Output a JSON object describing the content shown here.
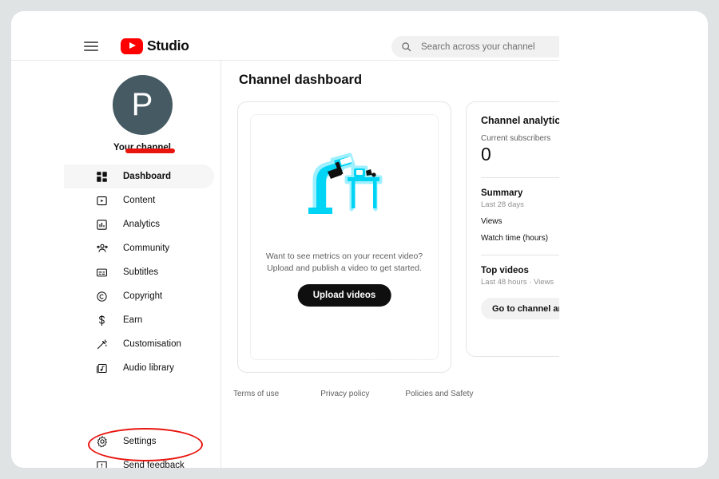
{
  "topbar": {
    "menu_icon": "hamburger-menu-icon",
    "brand_name": "Studio",
    "logo_icon": "youtube-logo-icon",
    "search": {
      "icon": "search-icon",
      "placeholder": "Search across your channel",
      "value": ""
    }
  },
  "sidebar": {
    "avatar_initial": "P",
    "channel_label": "Your channel",
    "items": [
      {
        "label": "Dashboard",
        "icon": "dashboard-grid-icon",
        "active": true
      },
      {
        "label": "Content",
        "icon": "content-video-icon",
        "active": false
      },
      {
        "label": "Analytics",
        "icon": "analytics-bar-icon",
        "active": false
      },
      {
        "label": "Community",
        "icon": "community-people-icon",
        "active": false
      },
      {
        "label": "Subtitles",
        "icon": "subtitles-icon",
        "active": false
      },
      {
        "label": "Copyright",
        "icon": "copyright-icon",
        "active": false
      },
      {
        "label": "Earn",
        "icon": "earn-dollar-icon",
        "active": false
      },
      {
        "label": "Customisation",
        "icon": "customisation-wand-icon",
        "active": false
      },
      {
        "label": "Audio library",
        "icon": "audio-library-icon",
        "active": false
      }
    ],
    "bottom_items": [
      {
        "label": "Settings",
        "icon": "settings-gear-icon"
      },
      {
        "label": "Send feedback",
        "icon": "send-feedback-icon"
      }
    ]
  },
  "annotations": {
    "underline_color": "#e8150f",
    "ellipse_color": "#e8150f",
    "underline_target": "Your channel",
    "ellipse_target": "Settings"
  },
  "main": {
    "page_title": "Channel dashboard",
    "upload_card": {
      "illustration": "person-filming-video-illustration",
      "illustration_color": "#26d9ee",
      "message_line1": "Want to see metrics on your recent video?",
      "message_line2": "Upload and publish a video to get started.",
      "upload_button": "Upload videos"
    },
    "analytics": {
      "title": "Channel analytics",
      "subscribers_label": "Current subscribers",
      "subscribers_value": "0",
      "summary_heading": "Summary",
      "summary_period": "Last 28 days",
      "metrics": [
        "Views",
        "Watch time (hours)"
      ],
      "top_videos_heading": "Top videos",
      "top_videos_period": "Last 48 hours · Views",
      "cta_button": "Go to channel analytics"
    },
    "footer_links": [
      "Terms of use",
      "Privacy policy",
      "Policies and Safety"
    ]
  }
}
